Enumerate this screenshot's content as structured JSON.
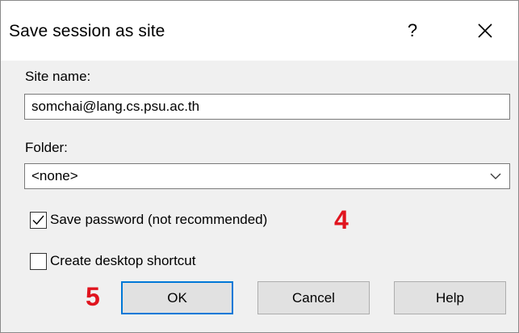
{
  "dialog": {
    "title": "Save session as site",
    "help_glyph": "?",
    "close_icon": "close-icon"
  },
  "site_name": {
    "label": "Site name:",
    "value": "somchai@lang.cs.psu.ac.th"
  },
  "folder": {
    "label": "Folder:",
    "value": "<none>"
  },
  "options": {
    "save_password": {
      "label": "Save password (not recommended)",
      "checked": true
    },
    "desktop_shortcut": {
      "label": "Create desktop shortcut",
      "checked": false
    }
  },
  "annotations": {
    "step4": "4",
    "step5": "5",
    "color": "#e0141e"
  },
  "buttons": {
    "ok": "OK",
    "cancel": "Cancel",
    "help": "Help"
  },
  "colors": {
    "focus_border": "#0078d7",
    "button_bg": "#e1e1e1",
    "dialog_bg": "#f0f0f0"
  }
}
